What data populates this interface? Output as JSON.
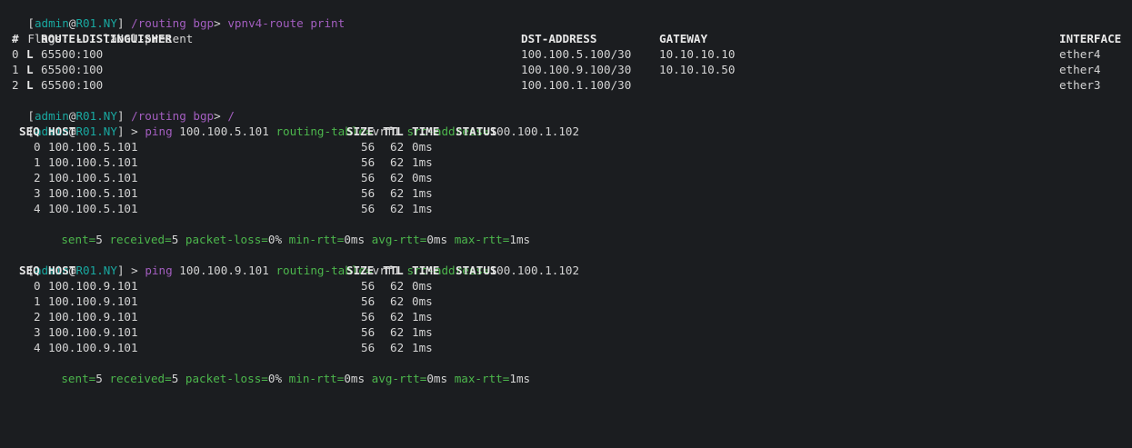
{
  "prompt": {
    "user": "admin",
    "at": "@",
    "host": "R01.NY",
    "open": "[",
    "close": "]"
  },
  "cmd1": {
    "path": "/routing bgp",
    "gt": ">",
    "command": "vpnv4-route print"
  },
  "flags": {
    "label": "Flags:",
    "flag": "L",
    "desc": "- label-present"
  },
  "route_table": {
    "headers": {
      "num": "#",
      "rd": "ROUTE-DISTINGUISHER",
      "dst": "DST-ADDRESS",
      "gw": "GATEWAY",
      "iface": "INTERFACE"
    },
    "rows": [
      {
        "num": "0",
        "flag": "L",
        "rd": "65500:100",
        "dst": "100.100.5.100/30",
        "gw": "10.10.10.10",
        "iface": "ether4"
      },
      {
        "num": "1",
        "flag": "L",
        "rd": "65500:100",
        "dst": "100.100.9.100/30",
        "gw": "10.10.10.50",
        "iface": "ether4"
      },
      {
        "num": "2",
        "flag": "L",
        "rd": "65500:100",
        "dst": "100.100.1.100/30",
        "gw": "",
        "iface": "ether3"
      }
    ]
  },
  "cmd2": {
    "path": "/routing bgp",
    "gt": ">",
    "command": "/"
  },
  "ping1": {
    "gt": ">",
    "cmd": "ping",
    "target": "100.100.5.101",
    "rt_key": "routing-table=",
    "rt_val": "vrf1",
    "src_key": "src-address=",
    "src_val": "100.100.1.102"
  },
  "ping_headers": {
    "seq": "SEQ",
    "host": "HOST",
    "size": "SIZE",
    "ttl": "TTL",
    "time": "TIME",
    "status": "STATUS"
  },
  "ping1_rows": [
    {
      "seq": "0",
      "host": "100.100.5.101",
      "size": "56",
      "ttl": "62",
      "time": "0ms"
    },
    {
      "seq": "1",
      "host": "100.100.5.101",
      "size": "56",
      "ttl": "62",
      "time": "1ms"
    },
    {
      "seq": "2",
      "host": "100.100.5.101",
      "size": "56",
      "ttl": "62",
      "time": "0ms"
    },
    {
      "seq": "3",
      "host": "100.100.5.101",
      "size": "56",
      "ttl": "62",
      "time": "1ms"
    },
    {
      "seq": "4",
      "host": "100.100.5.101",
      "size": "56",
      "ttl": "62",
      "time": "1ms"
    }
  ],
  "ping1_summary": {
    "sent_k": "sent=",
    "sent_v": "5",
    "recv_k": "received=",
    "recv_v": "5",
    "loss_k": "packet-loss=",
    "loss_v": "0%",
    "min_k": "min-rtt=",
    "min_v": "0ms",
    "avg_k": "avg-rtt=",
    "avg_v": "0ms",
    "max_k": "max-rtt=",
    "max_v": "1ms"
  },
  "ping2": {
    "gt": ">",
    "cmd": "ping",
    "target": "100.100.9.101",
    "rt_key": "routing-table=",
    "rt_val": "vrf1",
    "src_key": "src-address=",
    "src_val": "100.100.1.102"
  },
  "ping2_rows": [
    {
      "seq": "0",
      "host": "100.100.9.101",
      "size": "56",
      "ttl": "62",
      "time": "0ms"
    },
    {
      "seq": "1",
      "host": "100.100.9.101",
      "size": "56",
      "ttl": "62",
      "time": "0ms"
    },
    {
      "seq": "2",
      "host": "100.100.9.101",
      "size": "56",
      "ttl": "62",
      "time": "1ms"
    },
    {
      "seq": "3",
      "host": "100.100.9.101",
      "size": "56",
      "ttl": "62",
      "time": "1ms"
    },
    {
      "seq": "4",
      "host": "100.100.9.101",
      "size": "56",
      "ttl": "62",
      "time": "1ms"
    }
  ],
  "ping2_summary": {
    "sent_k": "sent=",
    "sent_v": "5",
    "recv_k": "received=",
    "recv_v": "5",
    "loss_k": "packet-loss=",
    "loss_v": "0%",
    "min_k": "min-rtt=",
    "min_v": "0ms",
    "avg_k": "avg-rtt=",
    "avg_v": "0ms",
    "max_k": "max-rtt=",
    "max_v": "1ms"
  },
  "colors": {
    "background": "#1b1d20",
    "prompt": "#19a8a0",
    "command": "#a35ec0",
    "key": "#4cb64c",
    "text": "#d4d4d4"
  }
}
